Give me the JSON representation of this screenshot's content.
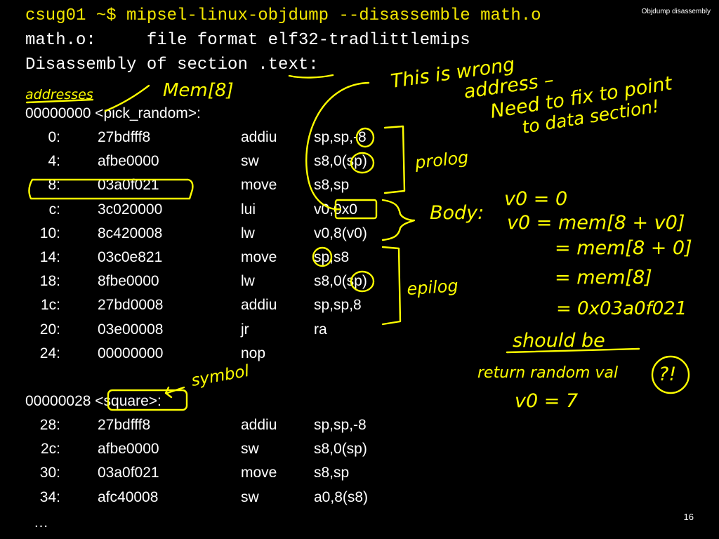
{
  "slide": {
    "corner_title": "Objdump disassembly",
    "page_number": "16",
    "command": "csug01 ~$ mipsel-linux-objdump --disassemble math.o",
    "file_line": "math.o:     file format elf32-tradlittlemips",
    "section_prefix": "Disassembly of section .",
    "section_name": "text",
    "section_suffix": ":",
    "ellipsis": "…"
  },
  "functions": [
    {
      "header": "00000000 <pick_random>:",
      "rows": [
        {
          "off": "0:",
          "hex": "27bdfff8",
          "op": "addiu",
          "args": "sp,sp,-8"
        },
        {
          "off": "4:",
          "hex": "afbe0000",
          "op": "sw",
          "args": "s8,0(sp)"
        },
        {
          "off": "8:",
          "hex": "03a0f021",
          "op": "move",
          "args": "s8,sp"
        },
        {
          "off": "c:",
          "hex": "3c020000",
          "op": "lui",
          "args": "v0,0x0"
        },
        {
          "off": "10:",
          "hex": "8c420008",
          "op": "lw",
          "args": "v0,8(v0)"
        },
        {
          "off": "14:",
          "hex": "03c0e821",
          "op": "move",
          "args": "sp,s8"
        },
        {
          "off": "18:",
          "hex": "8fbe0000",
          "op": "lw",
          "args": "s8,0(sp)"
        },
        {
          "off": "1c:",
          "hex": "27bd0008",
          "op": "addiu",
          "args": "sp,sp,8"
        },
        {
          "off": "20:",
          "hex": "03e00008",
          "op": "jr",
          "args": "ra"
        },
        {
          "off": "24:",
          "hex": "00000000",
          "op": "nop",
          "args": ""
        }
      ]
    },
    {
      "header_addr": "00000028 ",
      "header_sym": "<square>",
      "header_suffix": ":",
      "rows": [
        {
          "off": "28:",
          "hex": "27bdfff8",
          "op": "addiu",
          "args": "sp,sp,-8"
        },
        {
          "off": "2c:",
          "hex": "afbe0000",
          "op": "sw",
          "args": "s8,0(sp)"
        },
        {
          "off": "30:",
          "hex": "03a0f021",
          "op": "move",
          "args": "s8,sp"
        },
        {
          "off": "34:",
          "hex": "afc40008",
          "op": "sw",
          "args": "a0,8(s8)"
        }
      ]
    }
  ],
  "annotations": {
    "addresses": "addresses",
    "mem8": "Mem[8]",
    "wrong_1": "This is wrong",
    "wrong_2": "address –",
    "wrong_3": "Need to fix to point",
    "wrong_4": "to data section!",
    "prolog": "prolog",
    "body": "Body:",
    "calc_1": "v0 = 0",
    "calc_2": "v0 = mem[8 + v0]",
    "calc_3": "= mem[8 + 0]",
    "calc_4": "= mem[8]",
    "calc_5": "= 0x03a0f021",
    "epilog": "epilog",
    "should_be": "should be",
    "return_val": "return random val",
    "v0_7": "v0 = 7",
    "qmark": "?!",
    "symbol": "symbol"
  }
}
